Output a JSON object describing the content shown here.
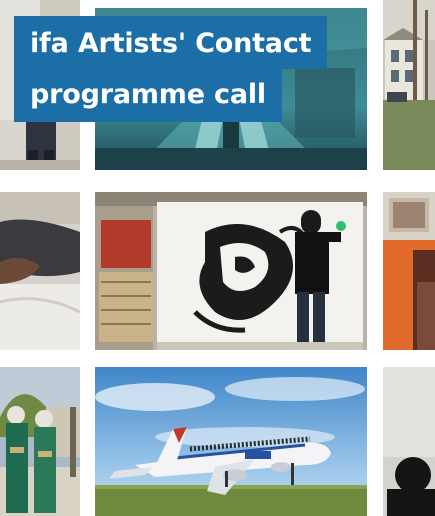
{
  "promo": {
    "title_line_1": "ifa Artists' Contact",
    "title_line_2": "programme call"
  },
  "colors": {
    "title_background": "#1b6fa6",
    "title_text": "#ffffff"
  },
  "tiles": [
    {
      "name": "photo-person-standing",
      "subject": "person standing"
    },
    {
      "name": "photo-escalator-hall",
      "subject": "escalator hall"
    },
    {
      "name": "photo-house-trees",
      "subject": "house with trees"
    },
    {
      "name": "photo-hands-cloth",
      "subject": "hands on cloth"
    },
    {
      "name": "photo-artist-painting-mural",
      "subject": "artist painting black ink mural"
    },
    {
      "name": "photo-orange-wall-person",
      "subject": "person by orange wall"
    },
    {
      "name": "photo-women-headscarves",
      "subject": "women in headscarves"
    },
    {
      "name": "photo-airplane-people-on-roof",
      "subject": "airplane with people on roof"
    },
    {
      "name": "photo-person-silhouette",
      "subject": "person silhouette"
    }
  ]
}
